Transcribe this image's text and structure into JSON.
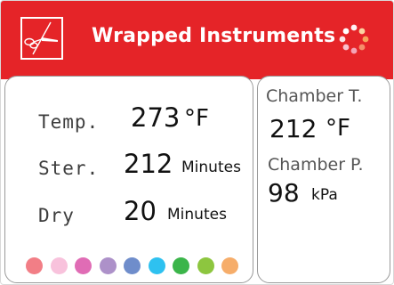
{
  "header": {
    "title": "Wrapped Instruments",
    "background_color": "#e52428",
    "logo_icon": "scissors-icon",
    "status_icon": "loading-spinner-icon"
  },
  "cycle": {
    "temp_label": "Temp.",
    "temp_value": "273",
    "temp_unit": "°F",
    "ster_label": "Ster.",
    "ster_value": "212",
    "ster_unit": "Minutes",
    "dry_label": "Dry",
    "dry_value": "20",
    "dry_unit": "Minutes"
  },
  "chamber": {
    "temp_label": "Chamber T.",
    "temp_value": "212",
    "temp_unit": "°F",
    "pressure_label": "Chamber P.",
    "pressure_value": "98",
    "pressure_unit": "kPa"
  },
  "color_dots": [
    "#f27e86",
    "#f8c2dc",
    "#e06cb5",
    "#ad91c9",
    "#6f8dcb",
    "#2ec1f0",
    "#3bb54a",
    "#8dc63f",
    "#f6ad6a"
  ]
}
